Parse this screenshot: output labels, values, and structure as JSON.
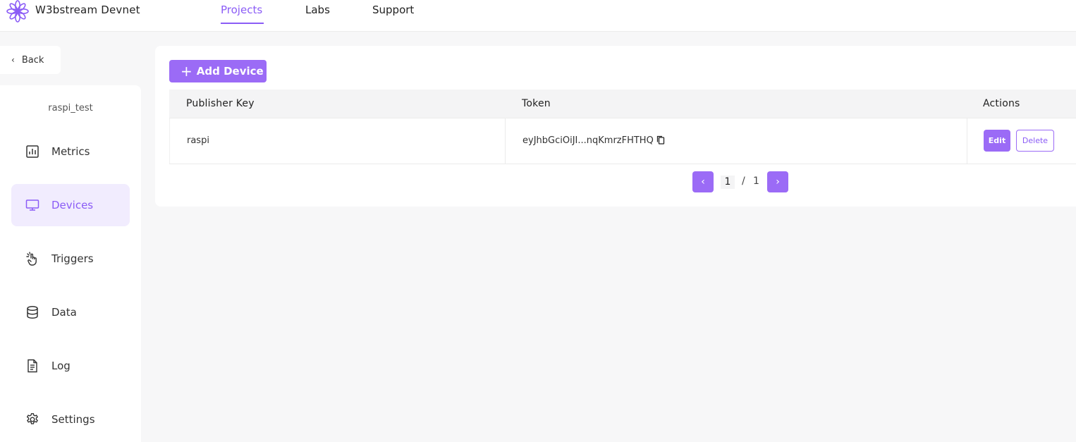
{
  "app": {
    "brand": "W3bstream Devnet"
  },
  "nav": {
    "projects": "Projects",
    "labs": "Labs",
    "support": "Support"
  },
  "sidebar": {
    "back": "Back",
    "project_name": "raspi_test",
    "items": [
      {
        "label": "Metrics",
        "icon": "bar-chart-icon"
      },
      {
        "label": "Devices",
        "icon": "monitor-icon"
      },
      {
        "label": "Triggers",
        "icon": "tap-hand-icon"
      },
      {
        "label": "Data",
        "icon": "database-icon"
      },
      {
        "label": "Log",
        "icon": "document-icon"
      },
      {
        "label": "Settings",
        "icon": "gear-icon"
      }
    ],
    "active": "Devices"
  },
  "main": {
    "add_device": "Add Device",
    "columns": {
      "publisher_key": "Publisher Key",
      "token": "Token",
      "actions": "Actions"
    },
    "rows": [
      {
        "publisher_key": "raspi",
        "token": "eyJhbGciOiJI...nqKmrzFHTHQ"
      }
    ],
    "edit_label": "Edit",
    "delete_label": "Delete",
    "pagination": {
      "current": "1",
      "separator": "/",
      "total": "1"
    }
  },
  "colors": {
    "accent": "#9b6bf6",
    "active_bg": "#f1ecfe",
    "background": "#f7f7f8"
  }
}
